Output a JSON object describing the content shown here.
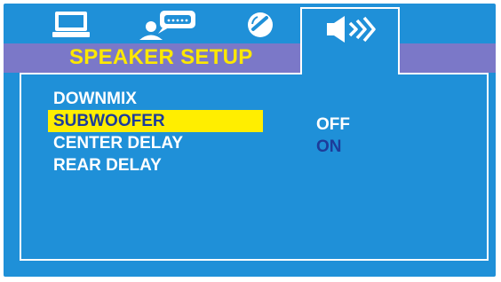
{
  "tabs": [
    {
      "icon": "monitor-icon",
      "active": false
    },
    {
      "icon": "person-speech-icon",
      "active": false
    },
    {
      "icon": "disc-icon",
      "active": false
    },
    {
      "icon": "speaker-icon",
      "active": true
    }
  ],
  "page_title": "SPEAKER SETUP",
  "menu_items": [
    {
      "label": "DOWNMIX",
      "selected": false
    },
    {
      "label": "SUBWOOFER",
      "selected": true
    },
    {
      "label": "CENTER DELAY",
      "selected": false
    },
    {
      "label": "REAR DELAY",
      "selected": false
    }
  ],
  "options": [
    {
      "label": "OFF",
      "highlighted": false
    },
    {
      "label": "ON",
      "highlighted": true
    }
  ],
  "colors": {
    "frame": "#1f90d8",
    "title_band": "#7b78c8",
    "title_text": "#fde800",
    "selection": "#ffee00",
    "selected_text": "#1d3c9a"
  }
}
